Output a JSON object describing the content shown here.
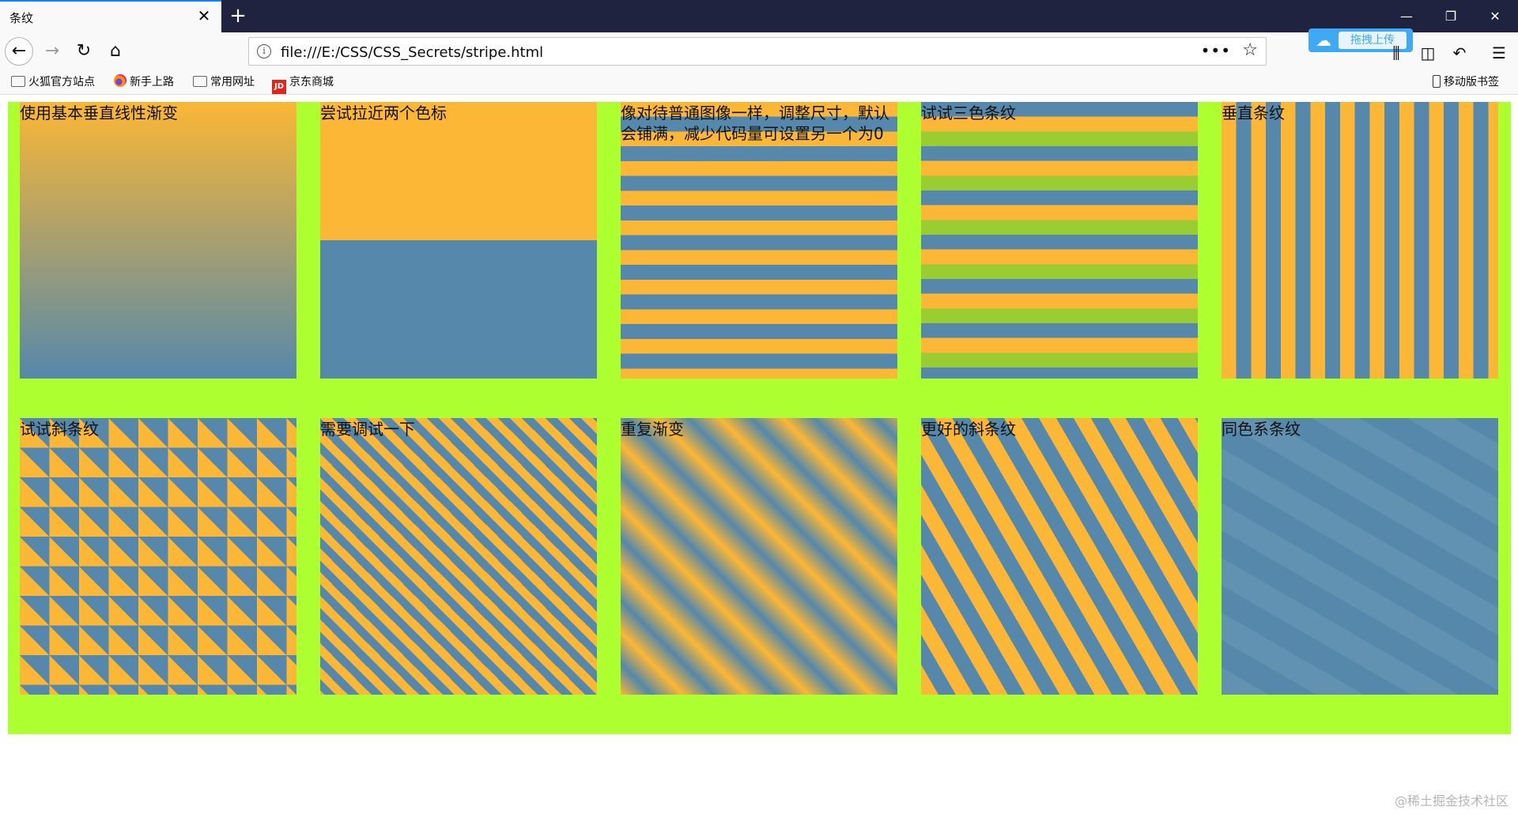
{
  "browser": {
    "tab_title": "条纹",
    "tab_close": "✕",
    "new_tab": "+",
    "url": "file:///E:/CSS/CSS_Secrets/stripe.html",
    "url_info": "i",
    "page_actions": "•••",
    "baidu_upload": "拖拽上传",
    "bookmarks": [
      "火狐官方站点",
      "新手上路",
      "常用网址",
      "京东商城"
    ],
    "mobile_bookmarks": "移动版书签",
    "window_controls": {
      "minimize": "—",
      "restore": "❐",
      "close": "✕"
    }
  },
  "colors": {
    "accent": "#fbb735",
    "secondary": "#58a",
    "page_bg": "#adff2f",
    "tertiary": "yellowgreen"
  },
  "demos": [
    {
      "label": "使用基本垂直线性渐变"
    },
    {
      "label": "尝试拉近两个色标"
    },
    {
      "label": "像对待普通图像一样，调整尺寸，默认会铺满，减少代码量可设置另一个为0"
    },
    {
      "label": "试试三色条纹"
    },
    {
      "label": "垂直条纹"
    },
    {
      "label": "试试斜条纹"
    },
    {
      "label": "需要调试一下"
    },
    {
      "label": "重复渐变"
    },
    {
      "label": "更好的斜条纹"
    },
    {
      "label": "同色系条纹"
    }
  ],
  "watermark": "@稀土掘金技术社区"
}
